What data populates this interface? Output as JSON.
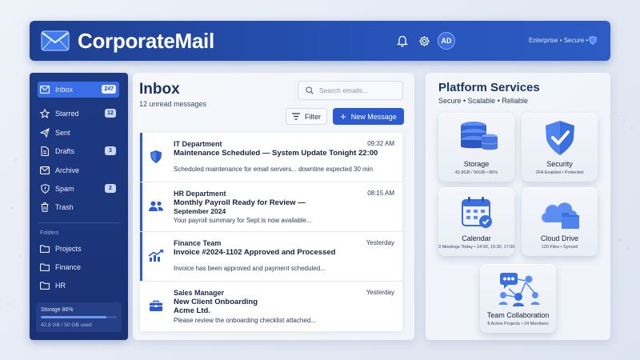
{
  "header": {
    "brand": "CorporateMail",
    "avatar_initials": "AD",
    "status_text": "Enterprise • Secure •",
    "icons": [
      "envelope-logo-icon",
      "bell-icon",
      "gear-icon",
      "shield-icon"
    ]
  },
  "sidebar": {
    "items": [
      {
        "label": "Inbox",
        "count": "247",
        "icon": "inbox-icon",
        "active": true
      },
      {
        "label": "Starred",
        "count": "12",
        "icon": "star-icon"
      },
      {
        "label": "Sent",
        "count": "",
        "icon": "send-icon"
      },
      {
        "label": "Drafts",
        "count": "3",
        "icon": "draft-icon"
      },
      {
        "label": "Archive",
        "count": "",
        "icon": "archive-icon"
      },
      {
        "label": "Spam",
        "count": "2",
        "icon": "spam-icon"
      },
      {
        "label": "Trash",
        "count": "",
        "icon": "trash-icon"
      }
    ],
    "folders_label": "Folders",
    "folders": [
      {
        "label": "Projects",
        "icon": "folder-icon"
      },
      {
        "label": "Finance",
        "icon": "folder-icon"
      },
      {
        "label": "HR",
        "icon": "folder-icon"
      }
    ],
    "storage": {
      "title": "Storage 86%",
      "used_text": "42.8 GB / 50 GB used",
      "percent": 86
    }
  },
  "inbox": {
    "title": "Inbox",
    "unread_text": "12 unread messages",
    "search_placeholder": "Search emails...",
    "filter_label": "Filter",
    "new_label": "New Message",
    "messages": [
      {
        "sender": "IT Department",
        "time": "09:32 AM",
        "subject": "Maintenance Scheduled — System Update Tonight 22:00",
        "preview": "Scheduled maintenance for email servers... downtine expected 30 min",
        "icon": "shield-icon",
        "unread": true
      },
      {
        "sender": "HR Department",
        "time": "08:15 AM",
        "subject": "Monthly Payroll Ready for Review —",
        "subject2": "September 2024",
        "preview": "Your payroll summary for Sept is now available...",
        "icon": "users-icon",
        "unread": true
      },
      {
        "sender": "Finance Team",
        "time": "Yesterday",
        "subject": "Invoice #2024-1102 Approved and Processed",
        "preview": "Invoice has been approved and payment scheduled...",
        "icon": "chart-icon",
        "unread": true
      },
      {
        "sender": "Sales Manager",
        "time": "Yesterday",
        "subject": "New Client Onboarding",
        "subject2": "Acme Ltd.",
        "preview": "Please review the onboarding checklist attached...",
        "icon": "briefcase-icon",
        "unread": false
      }
    ]
  },
  "platform": {
    "title": "Platform Services",
    "subtitle": "Secure • Scalable • Reliable",
    "tiles": [
      {
        "name": "Storage",
        "info": "42.8GB / 50GB • 86%",
        "icon": "database-icon"
      },
      {
        "name": "Security",
        "info": "2FA Enabled • Protected",
        "icon": "shield-check-icon"
      },
      {
        "name": "Calendar",
        "info": "3 Meetings Today • 14:00, 15:30, 17:00",
        "icon": "calendar-icon"
      },
      {
        "name": "Cloud Drive",
        "info": "120 Files • Synced",
        "icon": "cloud-folder-icon"
      },
      {
        "name": "Team Collaboration",
        "info": "8 Active Projects • 24 Members",
        "icon": "team-network-icon"
      }
    ]
  },
  "colors": {
    "primary": "#2c5bd1",
    "header": "#2753b8",
    "sidebar": "#1d3a84",
    "background": "#e6ebf5"
  }
}
